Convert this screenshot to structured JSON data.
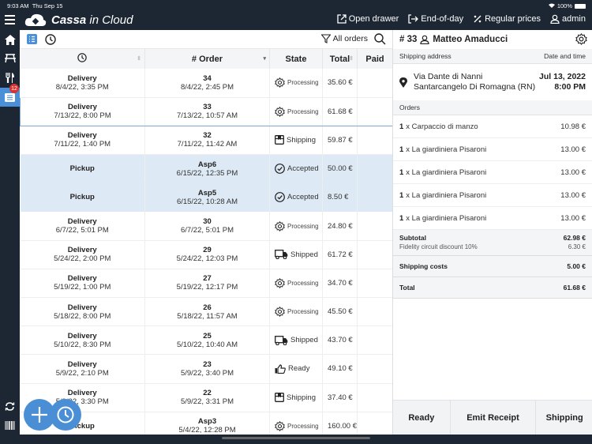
{
  "status_bar": {
    "time": "9:03 AM",
    "date": "Thu Sep 15",
    "battery": "100%"
  },
  "app": {
    "brand_bold": "Cassa",
    "brand_rest": " in Cloud"
  },
  "top_actions": [
    {
      "label": "Open drawer",
      "icon": "open-external-icon"
    },
    {
      "label": "End-of-day",
      "icon": "logout-icon"
    },
    {
      "label": "Regular prices",
      "icon": "percent-icon"
    },
    {
      "label": "admin",
      "icon": "user-icon"
    }
  ],
  "sidebar": {
    "items": [
      "home",
      "tables",
      "menu",
      "orders",
      "sync",
      "barcode"
    ],
    "orders_badge": "12"
  },
  "list_toolbar": {
    "filter_label": "All orders"
  },
  "table": {
    "headers": {
      "time": "",
      "order": "# Order",
      "state": "State",
      "total": "Total",
      "paid": "Paid"
    },
    "rows": [
      {
        "type": "Delivery",
        "time": "8/4/22, 3:35 PM",
        "number": "34",
        "created": "8/4/22, 2:45 PM",
        "state": "Processing",
        "state_icon": "gear",
        "total": "35.60 €",
        "paid": ""
      },
      {
        "type": "Delivery",
        "time": "7/13/22, 8:00 PM",
        "number": "33",
        "created": "7/13/22, 10:57 AM",
        "state": "Processing",
        "state_icon": "gear",
        "total": "61.68 €",
        "paid": "",
        "selected": true
      },
      {
        "type": "Delivery",
        "time": "7/11/22, 1:40 PM",
        "number": "32",
        "created": "7/11/22, 11:42 AM",
        "state": "Shipping",
        "state_icon": "box",
        "total": "59.87 €",
        "paid": ""
      },
      {
        "type": "Pickup",
        "time": "",
        "number": "Asp6",
        "created": "6/15/22, 12:35 PM",
        "state": "Accepted",
        "state_icon": "check",
        "total": "50.00 €",
        "paid": "",
        "highlight": true
      },
      {
        "type": "Pickup",
        "time": "",
        "number": "Asp5",
        "created": "6/15/22, 10:28 AM",
        "state": "Accepted",
        "state_icon": "check",
        "total": "8.50 €",
        "paid": "",
        "highlight": true
      },
      {
        "type": "Delivery",
        "time": "6/7/22, 5:01 PM",
        "number": "30",
        "created": "6/7/22, 5:01 PM",
        "state": "Processing",
        "state_icon": "gear",
        "total": "24.80 €",
        "paid": ""
      },
      {
        "type": "Delivery",
        "time": "5/24/22, 2:00 PM",
        "number": "29",
        "created": "5/24/22, 12:03 PM",
        "state": "Shipped",
        "state_icon": "truck",
        "total": "61.72 €",
        "paid": ""
      },
      {
        "type": "Delivery",
        "time": "5/19/22, 1:00 PM",
        "number": "27",
        "created": "5/19/22, 12:17 PM",
        "state": "Processing",
        "state_icon": "gear",
        "total": "34.70 €",
        "paid": ""
      },
      {
        "type": "Delivery",
        "time": "5/18/22, 8:00 PM",
        "number": "26",
        "created": "5/18/22, 11:57 AM",
        "state": "Processing",
        "state_icon": "gear",
        "total": "45.50 €",
        "paid": ""
      },
      {
        "type": "Delivery",
        "time": "5/10/22, 8:30 PM",
        "number": "25",
        "created": "5/10/22, 10:40 AM",
        "state": "Shipped",
        "state_icon": "truck",
        "total": "43.70 €",
        "paid": ""
      },
      {
        "type": "Delivery",
        "time": "5/9/22, 2:10 PM",
        "number": "23",
        "created": "5/9/22, 3:40 PM",
        "state": "Ready",
        "state_icon": "thumb",
        "total": "49.10 €",
        "paid": ""
      },
      {
        "type": "Delivery",
        "time": "5/9/22, 3:30 PM",
        "number": "22",
        "created": "5/9/22, 3:31 PM",
        "state": "Shipping",
        "state_icon": "box",
        "total": "37.40 €",
        "paid": ""
      },
      {
        "type": "Pickup",
        "time": "",
        "number": "Asp3",
        "created": "5/4/22, 12:28 PM",
        "state": "Processing",
        "state_icon": "gear",
        "total": "160.00 €",
        "paid": ""
      }
    ]
  },
  "detail": {
    "order_number": "# 33",
    "customer": "Matteo Amaducci",
    "shipping_header": "Shipping address",
    "datetime_header": "Date and time",
    "address_line1": "Via Dante di Nanni",
    "address_line2": "Santarcangelo Di Romagna (RN)",
    "date": "Jul 13, 2022",
    "time": "8:00 PM",
    "orders_header": "Orders",
    "items": [
      {
        "qty": "1",
        "name": "x Carpaccio di manzo",
        "price": "10.98 €"
      },
      {
        "qty": "1",
        "name": "x La giardiniera Pisaroni",
        "price": "13.00 €"
      },
      {
        "qty": "1",
        "name": "x La giardiniera Pisaroni",
        "price": "13.00 €"
      },
      {
        "qty": "1",
        "name": "x La giardiniera Pisaroni",
        "price": "13.00 €"
      },
      {
        "qty": "1",
        "name": "x La giardiniera Pisaroni",
        "price": "13.00 €"
      }
    ],
    "subtotal_label": "Subtotal",
    "subtotal": "62.98 €",
    "discount_label": "Fidelity circuit discount 10%",
    "discount": "6.30 €",
    "shipping_label": "Shipping costs",
    "shipping": "5.00 €",
    "total_label": "Total",
    "total": "61.68 €",
    "actions": {
      "ready": "Ready",
      "emit_receipt": "Emit Receipt",
      "shipping": "Shipping"
    }
  },
  "colors": {
    "accent": "#4a90d9",
    "dark": "#1c2733",
    "highlight": "#dde9f5",
    "badge": "#d9332f"
  }
}
